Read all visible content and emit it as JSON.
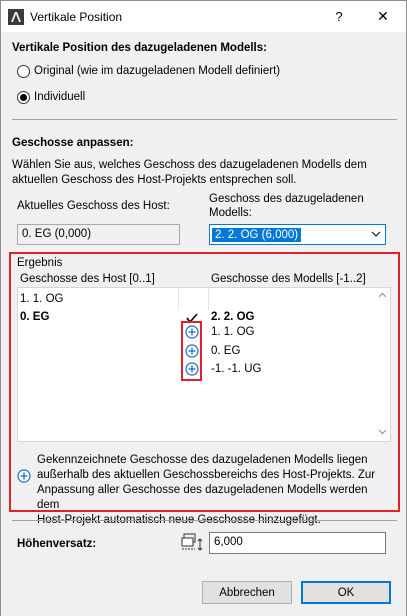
{
  "window": {
    "title": "Vertikale Position",
    "help_label": "?",
    "close_label": "✕"
  },
  "position_section": {
    "heading": "Vertikale Position des dazugeladenen Modells:",
    "option_original": "Original (wie im dazugeladenen Modell definiert)",
    "option_custom": "Individuell",
    "selected": "Individuell"
  },
  "floors_section": {
    "heading": "Geschosse anpassen:",
    "description_line1": "Wählen Sie aus, welches Geschoss des dazugeladenen Modells dem",
    "description_line2": "aktuellen Geschoss des Host-Projekts entsprechen soll.",
    "host_label": "Aktuelles Geschoss des Host:",
    "host_value": "0. EG (0,000)",
    "model_label_line1": "Geschoss des dazugeladenen",
    "model_label_line2": "Modells:",
    "model_value": "2. 2. OG (6,000)"
  },
  "result": {
    "heading": "Ergebnis",
    "col_host": "Geschosse des Host [0..1]",
    "col_model": "Geschosse des Modells [-1..2]",
    "host_rows": [
      {
        "label": "1. 1. OG",
        "bold": false
      },
      {
        "label": "0. EG",
        "bold": true
      }
    ],
    "model_rows": [
      {
        "label": "2. 2. OG",
        "bold": true,
        "marker": "check-icon"
      },
      {
        "label": "1. 1. OG",
        "bold": false,
        "marker": "plus-circle-icon"
      },
      {
        "label": "0. EG",
        "bold": false,
        "marker": "plus-circle-icon"
      },
      {
        "label": "-1. -1. UG",
        "bold": false,
        "marker": "plus-circle-icon"
      }
    ],
    "note": "Gekennzeichnete Geschosse des dazugeladenen Modells liegen außerhalb des aktuellen Geschossbereichs des Host-Projekts. Zur Anpassung aller Geschosse des dazugeladenen Modells werden dem Host-Projekt automatisch neue Geschosse hinzugefügt.",
    "note_line1": "Gekennzeichnete Geschosse des dazugeladenen Modells liegen",
    "note_line2": "außerhalb des aktuellen Geschossbereichs des Host-Projekts. Zur",
    "note_line3": "Anpassung aller Geschosse des dazugeladenen Modells werden dem",
    "note_line4": "Host-Projekt automatisch neue Geschosse hinzugefügt."
  },
  "offset": {
    "label": "Höhenversatz:",
    "value": "6,000"
  },
  "buttons": {
    "cancel": "Abbrechen",
    "ok": "OK"
  },
  "colors": {
    "highlight_red": "#e0212b",
    "accent_blue": "#0078d7"
  }
}
